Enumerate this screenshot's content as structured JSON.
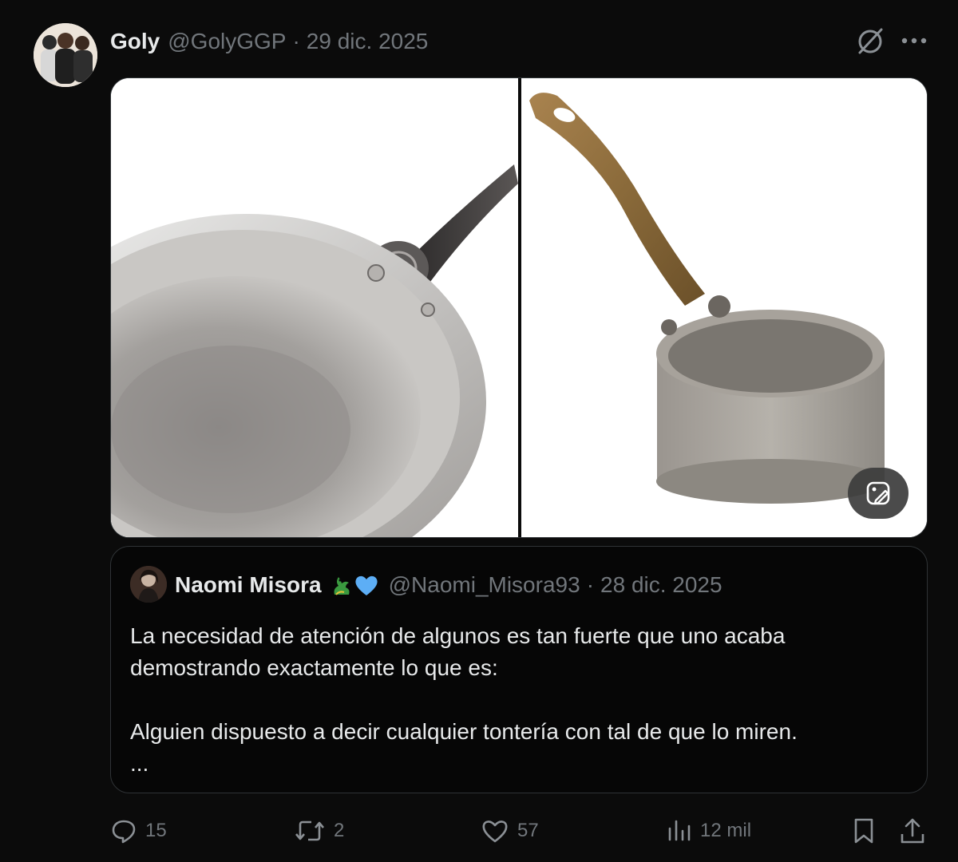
{
  "post": {
    "author_name": "Goly",
    "author_handle": "@GolyGGP",
    "separator": "·",
    "date": "29 dic. 2025"
  },
  "icons": {
    "grok": "grok-icon",
    "more": "more-icon",
    "alt_edit": "image-edit-icon"
  },
  "quoted": {
    "author_name": "Naomi Misora",
    "author_badges": [
      "dragon-emoji",
      "blue-heart-emoji"
    ],
    "author_handle": "@Naomi_Misora93",
    "separator": "·",
    "date": "28 dic. 2025",
    "text_line1": "La necesidad de atención de algunos es tan fuerte que uno acaba",
    "text_line2": "demostrando exactamente lo que es:",
    "text_line3": "Alguien dispuesto a decir cualquier tontería con tal de que lo miren.",
    "text_more": "..."
  },
  "actions": {
    "replies": "15",
    "reposts": "2",
    "likes": "57",
    "views": "12 mil"
  },
  "colors": {
    "background": "#0b0b0b",
    "text": "#e7e9ea",
    "muted": "#71767b",
    "border": "#2f3336"
  }
}
